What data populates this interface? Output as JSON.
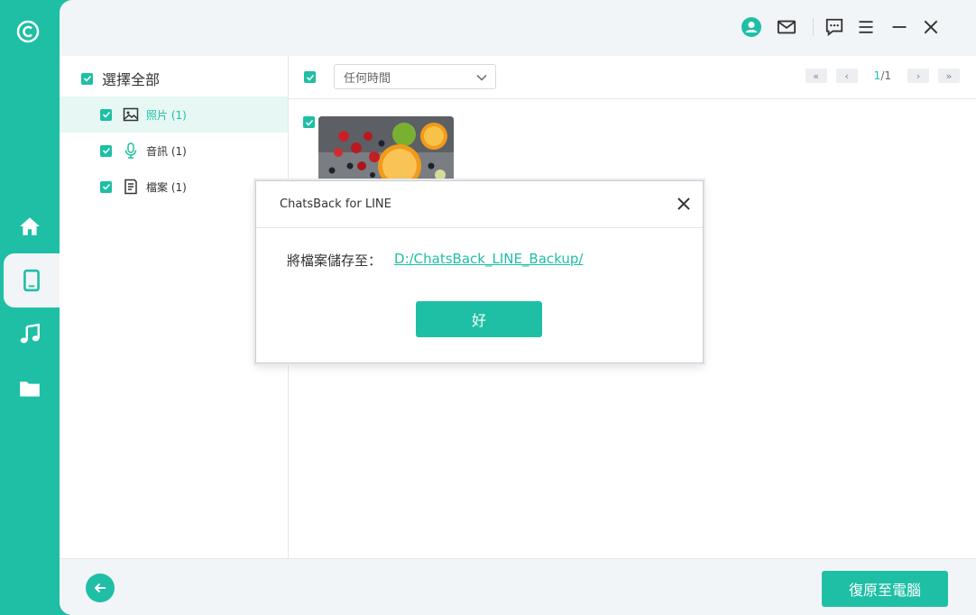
{
  "app": {
    "accent": "#1ebfa5",
    "titlebar_icons": [
      "account-icon",
      "mail-icon",
      "feedback-icon",
      "menu-icon",
      "minimize-icon",
      "close-icon"
    ],
    "rail_icons": [
      "logo-icon",
      "home-icon",
      "phone-icon",
      "music-icon",
      "folder-icon"
    ]
  },
  "sidebar": {
    "select_all": "選擇全部",
    "items": [
      {
        "label": "照片 (1)",
        "icon": "image-icon",
        "active": true
      },
      {
        "label": "音訊 (1)",
        "icon": "microphone-icon",
        "active": false
      },
      {
        "label": "檔案 (1)",
        "icon": "document-icon",
        "active": false
      }
    ]
  },
  "toolbar": {
    "time_filter": "任何時間",
    "pager": {
      "current": "1",
      "separator": "/",
      "total": "1"
    },
    "pager_buttons": [
      "«",
      "‹",
      "›",
      "»"
    ]
  },
  "footer": {
    "restore_button": "復原至電腦"
  },
  "dialog": {
    "title": "ChatsBack for LINE",
    "message": "將檔案儲存至：",
    "path": "D:/ChatsBack_LINE_Backup/",
    "ok": "好"
  }
}
